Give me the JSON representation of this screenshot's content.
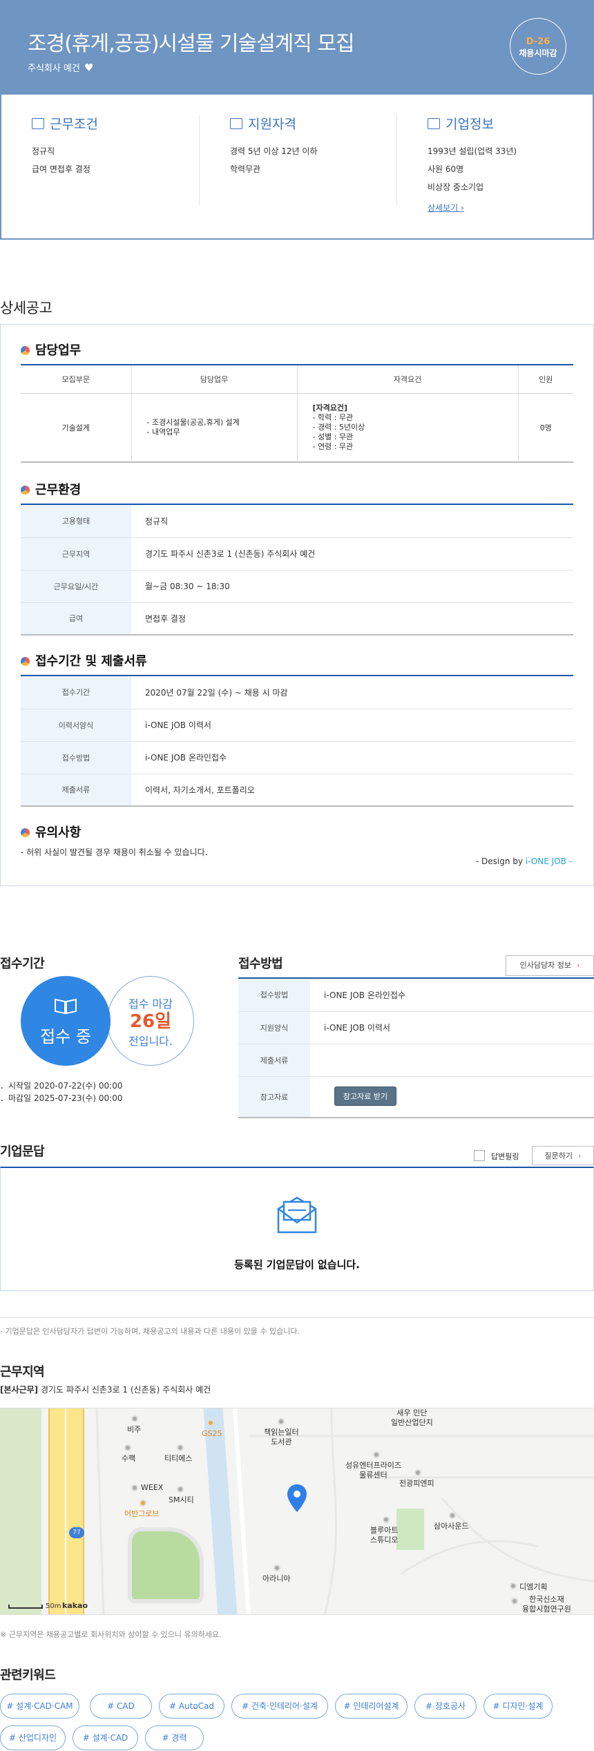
{
  "header": {
    "title": "조경(휴게,공공)시설물 기술설계직 모집",
    "company": "주식회사 예건",
    "dday": "D-26",
    "dday_sub": "채용시마감"
  },
  "summary": {
    "work": {
      "title": "근무조건",
      "lines": [
        "정규직",
        "급여 면접후 결정"
      ]
    },
    "qual": {
      "title": "지원자격",
      "lines": [
        "경력 5년 이상 12년 이하",
        "학력무관"
      ]
    },
    "company": {
      "title": "기업정보",
      "lines": [
        "1993년 설립(업력 33년)",
        "사원 60명",
        "비상장 중소기업"
      ],
      "link": "상세보기"
    }
  },
  "detail": {
    "title": "상세공고",
    "duty": {
      "title": "담당업무",
      "headers": [
        "모집부문",
        "담당업무",
        "자격요건",
        "인원"
      ],
      "row": {
        "dept": "기술설계",
        "tasks": [
          "- 조경시설물(공공,휴게) 설계",
          "- 내역업무"
        ],
        "req_title": "[자격요건]",
        "reqs": [
          "- 학력 : 무관",
          "- 경력 : 5년이상",
          "- 성별 : 무관",
          "- 연령 : 무관"
        ],
        "count": "0명"
      }
    },
    "env": {
      "title": "근무환경",
      "rows": [
        {
          "k": "고용형태",
          "v": "정규직"
        },
        {
          "k": "근무지역",
          "v": "경기도 파주시 신촌3로 1 (신촌동) 주식회사 예건"
        },
        {
          "k": "근무요일/시간",
          "v": "월~금 08:30 ~ 18:30"
        },
        {
          "k": "급여",
          "v": "면접후 결정"
        }
      ]
    },
    "apply": {
      "title": "접수기간 및 제출서류",
      "rows": [
        {
          "k": "접수기간",
          "v": "2020년 07월 22일 (수)  ~  채용 시 마감"
        },
        {
          "k": "이력서양식",
          "v": "i-ONE JOB 이력서"
        },
        {
          "k": "접수방법",
          "v": "i-ONE JOB 온라인접수"
        },
        {
          "k": "제출서류",
          "v": "이력서, 자기소개서, 포트폴리오"
        }
      ]
    },
    "notice": {
      "title": "유의사항",
      "text": "- 허위 사실이 발견될 경우 채용이 취소될 수 있습니다."
    },
    "design_prefix": "- Design by ",
    "design_brand": "i-ONE JOB -"
  },
  "receipt": {
    "title": "접수기간",
    "status": "접수 중",
    "deadline_label": "접수 마감",
    "deadline_days": "26일",
    "deadline_suffix": "전입니다.",
    "start": "시작일 2020-07-22(수) 00:00",
    "end": "마감일 2025-07-23(수) 00:00"
  },
  "method": {
    "title": "접수방법",
    "hr_button": "인사담당자 정보",
    "rows": [
      {
        "k": "접수방법",
        "v": "i-ONE JOB 온라인접수"
      },
      {
        "k": "지원양식",
        "v": "i-ONE JOB 이력서"
      },
      {
        "k": "제출서류",
        "v": ""
      },
      {
        "k": "참고자료",
        "v": ""
      }
    ],
    "ref_button": "참고자료 받기"
  },
  "qna": {
    "title": "기업문답",
    "answered_label": "답변필링",
    "ask_button": "질문하기",
    "empty": "등록된 기업문답이 없습니다.",
    "note": "- 기업문답은 인사담당자가 답변이 가능하며, 채용공고의 내용과 다른 내용이 있을 수 있습니다."
  },
  "location": {
    "title": "근무지역",
    "tag": "[본사근무]",
    "address": "경기도 파주시 신촌3로 1 (신촌동) 주식회사 예건",
    "note": "※ 근무지역은 채용공고별로 회사위치와 상이할 수 있으니 유의하세요.",
    "map_labels": {
      "biju": "비주",
      "gs25": "GS25",
      "library": "책읽는일터\n도서관",
      "industrial": "새우 민단\n일반산업단지",
      "supack": "수팩",
      "tities": "티티에스",
      "weex": "WEEX",
      "smcity": "SM시티",
      "marigold": "어반그로브",
      "seongyu": "성유엔터프라이즈\n물류센터",
      "jeongwang": "전광피엔피",
      "blueart": "블루아트\n스튜디오",
      "samasa": "삼아사운드",
      "arania": "아라니아",
      "dm": "디엠기획",
      "kr_research": "한국신소재\n융합시험연구원",
      "road": "77",
      "scale": "50m",
      "kakao": "kakao"
    }
  },
  "keywords": {
    "title": "관련키워드",
    "items": [
      "# 설계·CAD·CAM",
      "# CAD",
      "# AutoCad",
      "# 건축·인테리어·설계",
      "# 인테리어설계",
      "# 장호공사",
      "# 디자인·설계",
      "# 산업디자인",
      "# 설계·CAD",
      "# 경력"
    ]
  },
  "colors": {
    "hero": "#6f95c2",
    "accent": "#3b73c1",
    "orange": "#e8592e",
    "navy": "#1a56a8"
  }
}
